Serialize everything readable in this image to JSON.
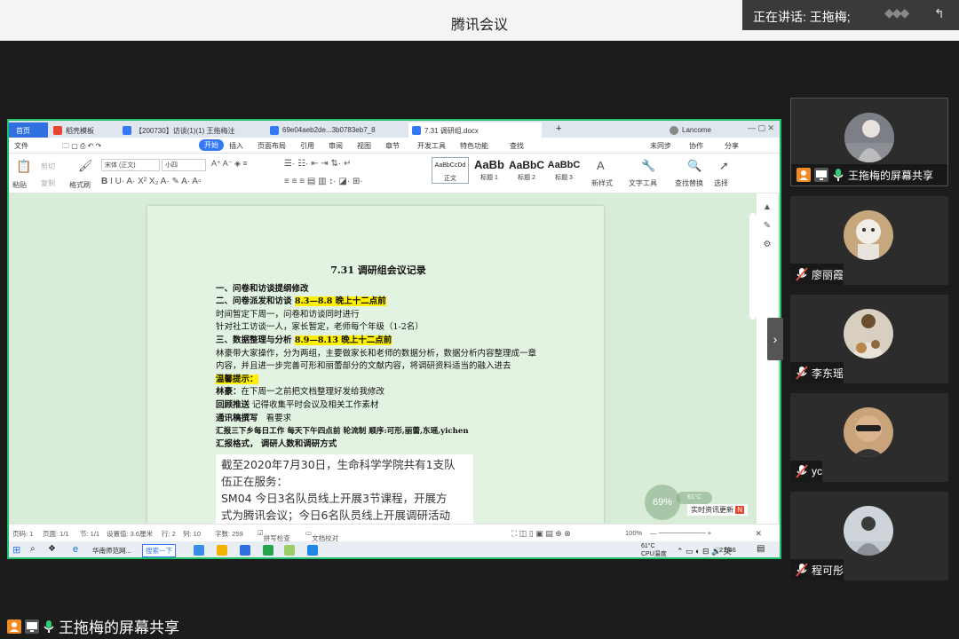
{
  "window": {
    "title": "腾讯会议"
  },
  "speaking": {
    "label": "正在讲话: 王拖梅;"
  },
  "wps": {
    "tabs": [
      {
        "label": "首页"
      },
      {
        "label": "稻壳模板"
      },
      {
        "label": "【200730】访谈(1)(1)  王拖梅注"
      },
      {
        "label": "69e04aeb2de...3b0783eb7_8"
      },
      {
        "label": "7.31 调研组.docx"
      },
      {
        "label": "Lancome"
      }
    ],
    "menu": [
      "文件",
      "开始",
      "插入",
      "页面布局",
      "引用",
      "审阅",
      "视图",
      "章节",
      "开发工具",
      "特色功能",
      "查找",
      "未同步",
      "协作",
      "分享"
    ],
    "ribbon": {
      "paste": "粘贴",
      "cut": "剪切",
      "copy": "复制",
      "format_painter": "格式刷",
      "font": "宋体 (正文)",
      "size": "小四",
      "styles": [
        {
          "preview": "AaBbCcDd",
          "name": "正文"
        },
        {
          "preview": "AaBb",
          "name": "标题 1"
        },
        {
          "preview": "AaBbC",
          "name": "标题 2"
        },
        {
          "preview": "AaBbC",
          "name": "标题 3"
        }
      ],
      "new_style": "新样式",
      "text_tools": "文字工具",
      "find_replace": "查找替换",
      "select": "选择"
    },
    "document": {
      "title": "7.31 调研组会议记录",
      "line1": "一、问卷和访谈提纲修改",
      "line2_a": "二、问卷派发和访谈",
      "line2_b": "8.3—8.8 晚上十二点前",
      "line3": "时间暂定下周一，问卷和访谈同时进行",
      "line4": "针对社工访谈一人，家长暂定，老师每个年级（1-2名）",
      "line5_a": "三、数据整理与分析",
      "line5_b": "8.9—8.13 晚上十二点前",
      "line6": "林豪带大家操作，分为两组，主要做家长和老师的数据分析，数据分析内容整理成一章内容，并且进一步完善可形和丽蕾部分的文献内容，将调研资料适当的融入进去",
      "tips_title": "温馨提示：",
      "tip1_a": "林豪：",
      "tip1_b": "在下周一之前把文档整理好发给我修改",
      "tip2_a": "回顾推送",
      "tip2_b": "记得收集平时会议及相关工作素材",
      "tip3_a": "通讯稿撰写",
      "tip3_b": "看要求",
      "tip4": "汇报三下乡每日工作   每天下午四点前  轮流制  顺序:可形,丽蕾,东瑶,yichen",
      "tip5": "汇报格式，   调研人数和调研方式"
    },
    "snippet": {
      "line1": "截至2020年7月30日，生命科学学院共有1支队",
      "line2": "伍正在服务：",
      "line3": "SM04 今日3名队员线上开展3节课程，开展方",
      "line4": "式为腾讯会议；今日6名队员线上开展调研活动"
    },
    "status": {
      "page": "页码: 1",
      "pages": "页面: 1/1",
      "section": "节: 1/1",
      "setting": "设置值: 3.6厘米",
      "row": "行: 2",
      "col": "列: 10",
      "words": "字数: 259",
      "spell": "拼写检查",
      "proof": "文档校对",
      "zoom": "100%"
    },
    "cpu_percent": "69%",
    "cpu_temp": "61°C",
    "cpu_label": "CPU温度",
    "temp_pill": "61°C",
    "news": "实时资讯更新",
    "taskbar": {
      "ie": "华南师范网...",
      "search": "搜索一下",
      "time": "21:46"
    }
  },
  "participants": [
    {
      "name": "王拖梅的屏幕共享",
      "active": true
    },
    {
      "name": "廖丽霞"
    },
    {
      "name": "李东瑶"
    },
    {
      "name": "yc"
    },
    {
      "name": "程可彤"
    }
  ],
  "share_label": "王拖梅的屏幕共享",
  "colors": {
    "share_border": "#1fc06b",
    "highlight": "#ffef00",
    "wps_blue": "#2f6fe0"
  }
}
